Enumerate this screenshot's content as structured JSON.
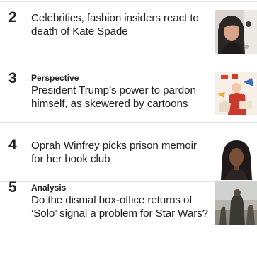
{
  "stories": [
    {
      "rank": "2",
      "label": "",
      "headline": "Celebrities, fashion insiders react to death of Kate Spade",
      "thumbnail": "woman-portrait-photo"
    },
    {
      "rank": "3",
      "label": "Perspective",
      "headline": "President Trump’s power to pardon himself, as skewered by cartoons",
      "thumbnail": "political-cartoon-image"
    },
    {
      "rank": "4",
      "label": "",
      "headline": "Oprah Winfrey picks prison memoir for her book club",
      "thumbnail": "author-portrait-photo"
    },
    {
      "rank": "5",
      "label": "Analysis",
      "headline": "Do the dismal box-office returns of ‘Solo’ signal a problem for Star Wars?",
      "thumbnail": "movie-still-photo"
    }
  ]
}
